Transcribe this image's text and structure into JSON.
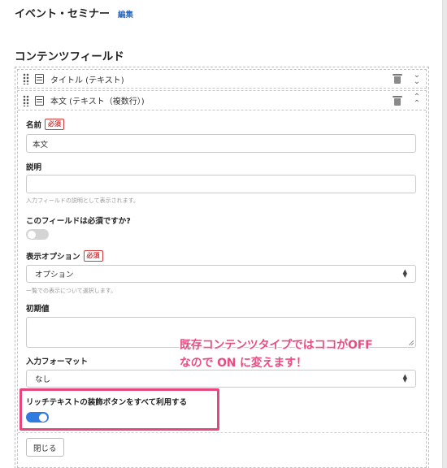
{
  "header": {
    "title": "イベント・セミナー",
    "edit_link": "編集"
  },
  "section": {
    "title": "コンテンツフィールド"
  },
  "fields": [
    {
      "label": "タイトル (テキスト)",
      "expanded": false
    },
    {
      "label": "本文 (テキスト（複数行）)",
      "expanded": true
    }
  ],
  "form": {
    "name_label": "名前",
    "required_badge": "必須",
    "name_value": "本文",
    "description_label": "説明",
    "description_value": "",
    "description_help": "入力フィールドの説明として表示されます。",
    "required_question": "このフィールドは必須ですか?",
    "required_toggle": "off",
    "display_option_label": "表示オプション",
    "display_option_value": "オプション",
    "display_option_help": "一覧での表示について選択します。",
    "initial_value_label": "初期値",
    "initial_value": "",
    "input_format_label": "入力フォーマット",
    "input_format_value": "なし",
    "rich_text_label": "リッチテキストの装飾ボタンをすべて利用する",
    "rich_text_toggle": "on",
    "close_button": "閉じる"
  },
  "annotation": {
    "line1": "既存コンテンツタイプではココがOFF",
    "line2": "なので ON に変えます！",
    "color": "#ea4d82"
  },
  "colors": {
    "link": "#2a6fc1",
    "required": "#d43a3a",
    "toggle_on": "#2f7be0",
    "highlight": "#e8457a"
  }
}
